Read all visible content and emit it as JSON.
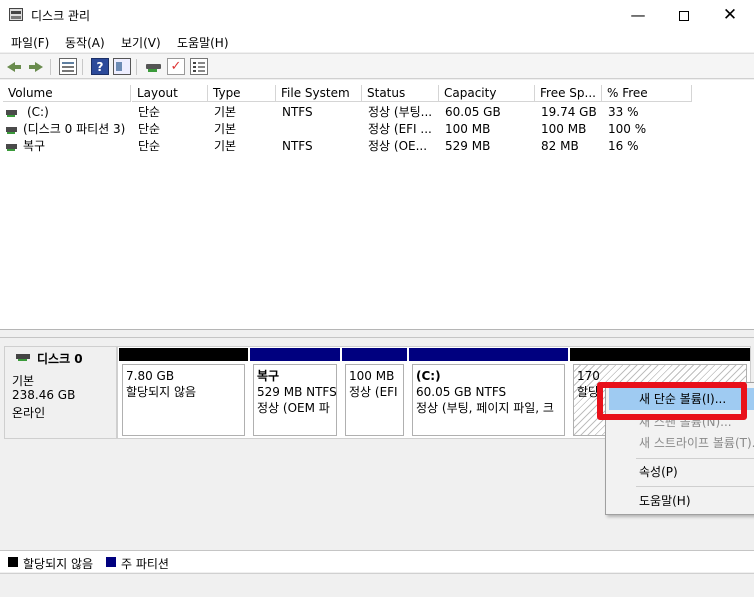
{
  "window": {
    "title": "디스크 관리",
    "minimize_glyph": "—",
    "close_glyph": "✕"
  },
  "menu": [
    "파일(F)",
    "동작(A)",
    "보기(V)",
    "도움말(H)"
  ],
  "toolbar": {
    "icons": [
      "back-icon",
      "forward-icon",
      "console-tree-icon",
      "help-icon",
      "show-pane-icon",
      "connect-disk-icon",
      "rescan-check-icon",
      "properties-icon"
    ],
    "help_glyph": "?",
    "check_glyph": "✓"
  },
  "volume_list": {
    "columns": [
      "Volume",
      "Layout",
      "Type",
      "File System",
      "Status",
      "Capacity",
      "Free Sp...",
      "% Free"
    ],
    "rows": [
      {
        "volume": "(C:)",
        "layout": "단순",
        "type": "기본",
        "fs": "NTFS",
        "status": "정상 (부팅...",
        "capacity": "60.05 GB",
        "free": "19.74 GB",
        "pct": "33 %"
      },
      {
        "volume": "(디스크 0 파티션 3)",
        "layout": "단순",
        "type": "기본",
        "fs": "",
        "status": "정상 (EFI ...",
        "capacity": "100 MB",
        "free": "100 MB",
        "pct": "100 %"
      },
      {
        "volume": "복구",
        "layout": "단순",
        "type": "기본",
        "fs": "NTFS",
        "status": "정상 (OE...",
        "capacity": "529 MB",
        "free": "82 MB",
        "pct": "16 %"
      }
    ]
  },
  "disk": {
    "name": "디스크 0",
    "type": "기본",
    "size": "238.46 GB",
    "state": "온라인",
    "partitions": [
      {
        "title": "",
        "line1": "7.80 GB",
        "line2": "할당되지 않음",
        "bar_color": "#000000"
      },
      {
        "title": "복구",
        "line1": "529 MB NTFS",
        "line2": "정상 (OEM 파",
        "bar_color": "#00007f"
      },
      {
        "title": "",
        "line1": "100 MB",
        "line2": "정상 (EFI",
        "bar_color": "#00007f"
      },
      {
        "title": "(C:)",
        "line1": "60.05 GB NTFS",
        "line2": "정상 (부팅, 페이지 파일, 크",
        "bar_color": "#00007f"
      },
      {
        "title": "",
        "line1": "170",
        "line2": "할당",
        "bar_color": "#000000"
      }
    ]
  },
  "legend": [
    {
      "label": "할당되지 않음",
      "color": "#000000"
    },
    {
      "label": "주 파티션",
      "color": "#00007f"
    }
  ],
  "context_menu": {
    "items": [
      {
        "label": "새 단순 볼륨(I)...",
        "state": "selected"
      },
      {
        "label": "새 스팬 볼륨(N)...",
        "state": "disabled"
      },
      {
        "label": "새 스트라이프 볼륨(T)...",
        "state": "disabled"
      },
      {
        "label": "속성(P)",
        "state": "enabled"
      },
      {
        "label": "도움말(H)",
        "state": "enabled"
      }
    ]
  }
}
